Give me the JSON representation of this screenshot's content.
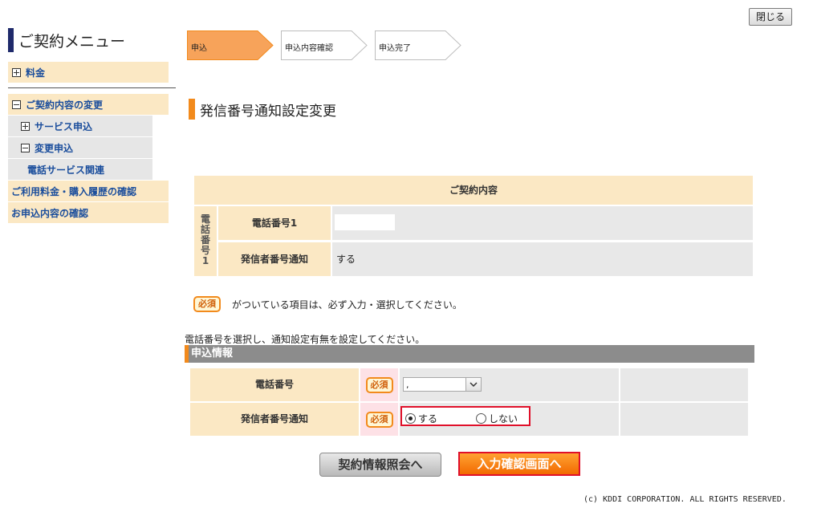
{
  "header": {
    "close_label": "閉じる"
  },
  "sidebar": {
    "title": "ご契約メニュー",
    "items": [
      {
        "label": "料金",
        "state": "plus"
      },
      {
        "label": "ご契約内容の変更",
        "state": "minus"
      },
      {
        "label": "サービス申込",
        "state": "plus"
      },
      {
        "label": "変更申込",
        "state": "minus"
      },
      {
        "label": "電話サービス関連"
      },
      {
        "label": "ご利用料金・購入履歴の確認"
      },
      {
        "label": "お申込内容の確認"
      }
    ]
  },
  "steps": [
    {
      "label": "申込",
      "active": true
    },
    {
      "label": "申込内容確認",
      "active": false
    },
    {
      "label": "申込完了",
      "active": false
    }
  ],
  "page_title": "発信番号通知設定変更",
  "contract": {
    "header": "ご契約内容",
    "group_label": "電話番号1",
    "rows": [
      {
        "label": "電話番号1",
        "value": ""
      },
      {
        "label": "発信者番号通知",
        "value": "する"
      }
    ]
  },
  "required_note": {
    "badge": "必須",
    "text": "がついている項目は、必ず入力・選択してください。"
  },
  "instruction": "電話番号を選択し、通知設定有無を設定してください。",
  "application": {
    "header": "申込情報",
    "phone": {
      "label": "電話番号",
      "badge": "必須",
      "selected": ","
    },
    "notify": {
      "label": "発信者番号通知",
      "badge": "必須",
      "options": [
        {
          "label": "する",
          "checked": true
        },
        {
          "label": "しない",
          "checked": false
        }
      ]
    }
  },
  "buttons": {
    "back": "契約情報照会へ",
    "next": "入力確認画面へ"
  },
  "footer": {
    "copyright": "(c) KDDI CORPORATION. ALL RIGHTS RESERVED."
  },
  "colors": {
    "accent": "#f28a1c",
    "navy": "#1f2a6b",
    "beige": "#fbe8c4",
    "highlight_red": "#e0102a"
  }
}
